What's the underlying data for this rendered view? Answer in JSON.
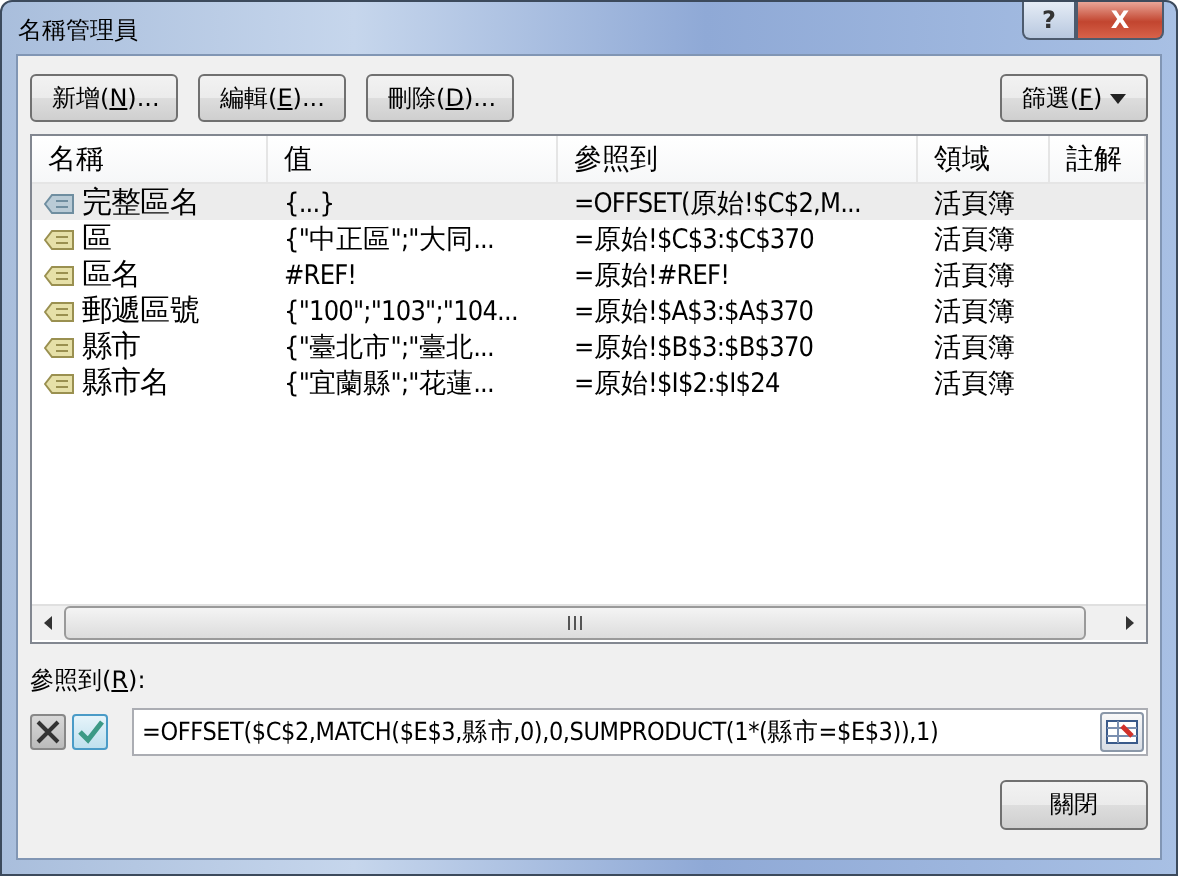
{
  "window": {
    "title": "名稱管理員",
    "help_button": "?",
    "close_button": "X"
  },
  "toolbar": [
    {
      "before": "新增(",
      "accel": "N",
      "after": ")..."
    },
    {
      "before": "編輯(",
      "accel": "E",
      "after": ")..."
    },
    {
      "before": "刪除(",
      "accel": "D",
      "after": ")..."
    }
  ],
  "filter_button": {
    "before": "篩選(",
    "accel": "F",
    "after": ")"
  },
  "table": {
    "columns": [
      "名稱",
      "值",
      "參照到",
      "領域",
      "註解"
    ],
    "rows": [
      {
        "selected": true,
        "cells": [
          "完整區名",
          "{...}",
          "=OFFSET(原始!$C$2,M...",
          "活頁簿"
        ]
      },
      {
        "selected": false,
        "cells": [
          "區",
          "{\"中正區\";\"大同...",
          "=原始!$C$3:$C$370",
          "活頁簿"
        ]
      },
      {
        "selected": false,
        "cells": [
          "區名",
          "#REF!",
          "=原始!#REF!",
          "活頁簿"
        ]
      },
      {
        "selected": false,
        "cells": [
          "郵遞區號",
          "{\"100\";\"103\";\"104...",
          "=原始!$A$3:$A$370",
          "活頁簿"
        ]
      },
      {
        "selected": false,
        "cells": [
          "縣市",
          "{\"臺北市\";\"臺北...",
          "=原始!$B$3:$B$370",
          "活頁簿"
        ]
      },
      {
        "selected": false,
        "cells": [
          "縣市名",
          "{\"宜蘭縣\";\"花蓮...",
          "=原始!$I$2:$I$24",
          "活頁簿"
        ]
      }
    ]
  },
  "refers_to": {
    "label": {
      "before": "參照到(",
      "accel": "R",
      "after": "):"
    },
    "value": "=OFFSET($C$2,MATCH($E$3,縣市,0),0,SUMPRODUCT(1*(縣市=$E$3)),1)"
  },
  "close_dialog_button": "關閉"
}
